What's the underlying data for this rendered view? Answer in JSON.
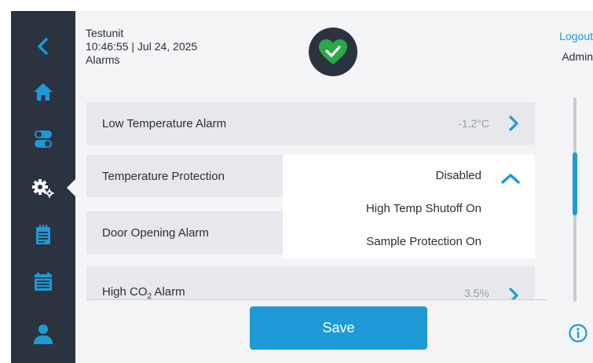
{
  "header": {
    "unit_name": "Testunit",
    "datetime": "10:46:55 | Jul 24, 2025",
    "page_title": "Alarms",
    "logout_label": "Logout",
    "user_label": "Admin",
    "status_icon": "heart-check-icon",
    "status_color": "#2aa84a"
  },
  "sidebar": {
    "items": [
      {
        "name": "back",
        "icon": "chevron-left-icon"
      },
      {
        "name": "home",
        "icon": "home-icon"
      },
      {
        "name": "controls",
        "icon": "toggle-icon"
      },
      {
        "name": "settings",
        "icon": "gears-icon",
        "active": true
      },
      {
        "name": "log",
        "icon": "clipboard-icon"
      },
      {
        "name": "data",
        "icon": "calendar-list-icon"
      },
      {
        "name": "user",
        "icon": "user-icon"
      }
    ]
  },
  "alarms": {
    "low_temp": {
      "label": "Low Temperature Alarm",
      "value": "-1.2°C"
    },
    "temp_protection": {
      "label": "Temperature Protection",
      "selected": "Disabled",
      "options": [
        "High Temp Shutoff On",
        "Sample Protection On"
      ]
    },
    "door": {
      "label": "Door Opening Alarm"
    },
    "co2": {
      "label_main": "High CO",
      "label_sub": "2",
      "label_tail": " Alarm",
      "value": "3.5%"
    }
  },
  "save_label": "Save",
  "colors": {
    "accent": "#1e9ad6",
    "sidebar_bg": "#2b3340",
    "row_bg": "#e7e8eb",
    "status_ok": "#2aa84a"
  }
}
